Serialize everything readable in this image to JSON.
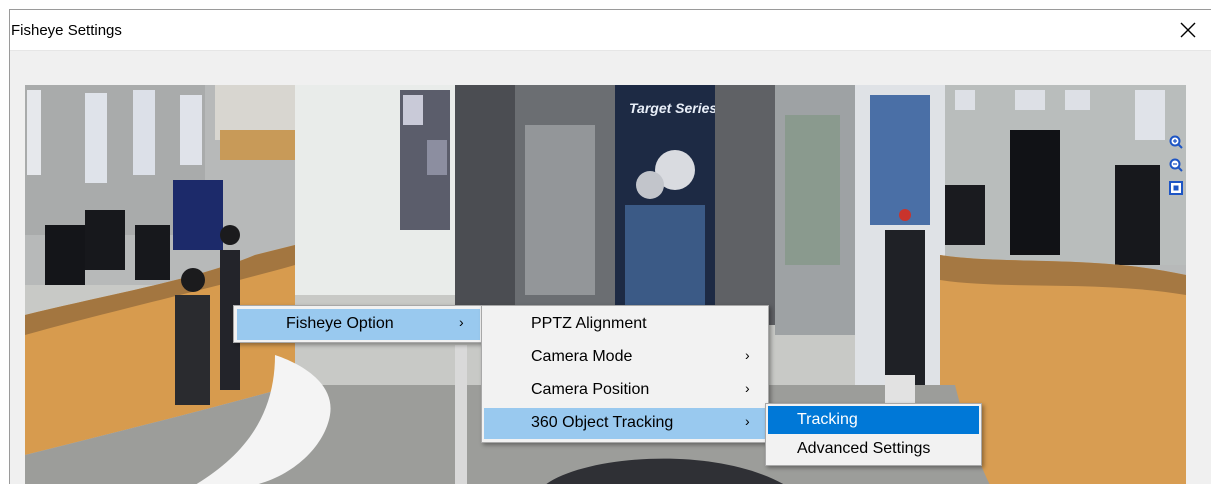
{
  "window": {
    "title": "Fisheye Settings"
  },
  "menus": {
    "main": {
      "items": [
        {
          "label": "Fisheye Option",
          "arrow": "›"
        }
      ]
    },
    "fisheye_option": {
      "items": [
        {
          "label": "PPTZ Alignment"
        },
        {
          "label": "Camera Mode",
          "arrow": "›"
        },
        {
          "label": "Camera Position",
          "arrow": "›"
        },
        {
          "label": "360 Object Tracking",
          "arrow": "›"
        }
      ]
    },
    "tracking": {
      "items": [
        {
          "label": "Tracking"
        },
        {
          "label": "Advanced Settings"
        }
      ]
    }
  },
  "camera_view": {
    "banner_text": "Target Series"
  },
  "colors": {
    "menu_highlight_light": "#99c9ef",
    "menu_highlight_selected": "#0078d7",
    "menu_background": "#f2f2f2"
  }
}
